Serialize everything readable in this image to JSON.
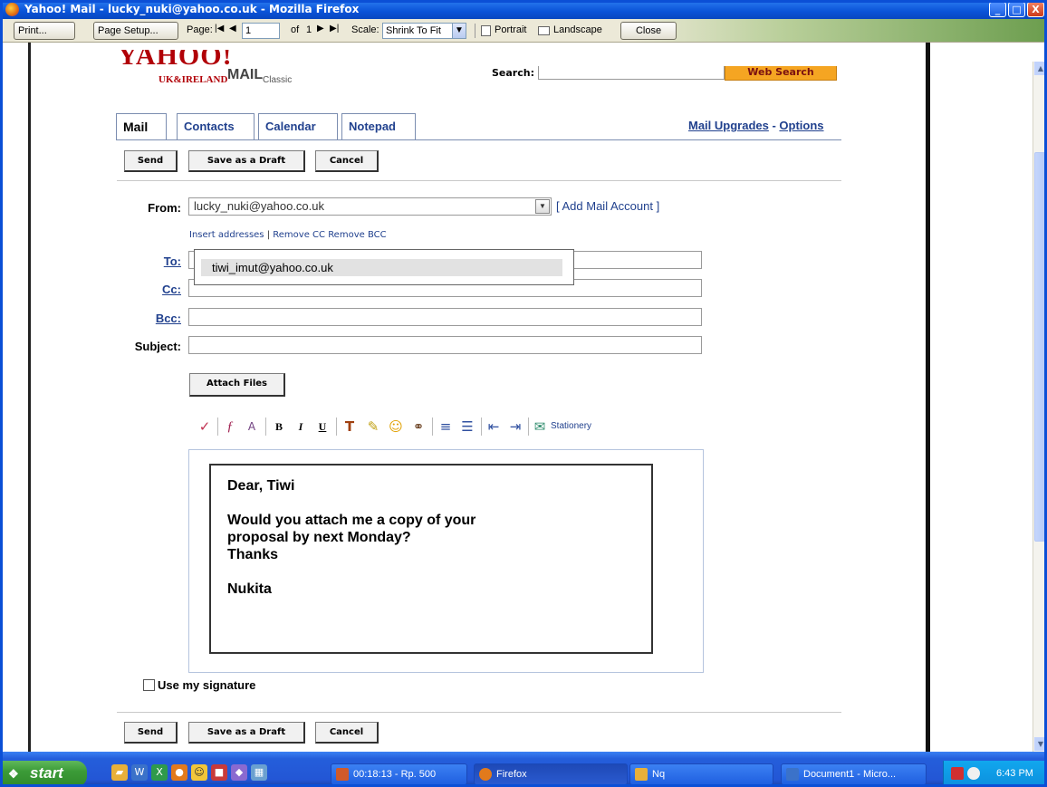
{
  "window": {
    "title": "Yahoo! Mail - lucky_nuki@yahoo.co.uk - Mozilla Firefox",
    "min": "_",
    "max": "□",
    "close": "X"
  },
  "print_toolbar": {
    "print": "Print...",
    "page_setup": "Page Setup...",
    "page_label": "Page:",
    "first": "|◀",
    "prev": "◀",
    "page_value": "1",
    "of_label": "of",
    "total_pages": "1",
    "next": "▶",
    "last": "▶|",
    "scale_label": "Scale:",
    "scale_value": "Shrink To Fit",
    "portrait": "Portrait",
    "landscape": "Landscape",
    "close": "Close"
  },
  "header": {
    "logo": "YAHOO!",
    "logo_mail": "MAIL",
    "logo_region": "UK&IRELAND",
    "logo_classic": "Classic",
    "search_label": "Search:",
    "search_value": "",
    "web_search": "Web Search"
  },
  "tabs": [
    {
      "label": "Mail"
    },
    {
      "label": "Contacts"
    },
    {
      "label": "Calendar"
    },
    {
      "label": "Notepad"
    }
  ],
  "top_links": {
    "upgrades": "Mail Upgrades",
    "sep": " - ",
    "options": "Options"
  },
  "actions": {
    "send": "Send",
    "draft": "Save as a Draft",
    "cancel": "Cancel"
  },
  "form": {
    "from_label": "From:",
    "from_value": "lucky_nuki@yahoo.co.uk",
    "add_account": "[ Add Mail Account ]",
    "insert_addresses": "Insert addresses",
    "remove_cc": "Remove CC",
    "remove_bcc": "Remove BCC",
    "to_label": "To:",
    "cc_label": "Cc:",
    "bcc_label": "Bcc:",
    "subject_label": "Subject:",
    "autocomplete_option": "tiwi_imut@yahoo.co.uk",
    "attach": "Attach Files"
  },
  "format_toolbar": {
    "items": [
      "spellcheck-icon",
      "font-icon",
      "font-size-icon",
      "bold-icon",
      "italic-icon",
      "underline-icon",
      "text-color-icon",
      "highlight-icon",
      "emoticon-icon",
      "link-icon",
      "align-icon",
      "bullets-icon",
      "outdent-icon",
      "indent-icon",
      "stationery-icon"
    ],
    "bold": "B",
    "italic": "I",
    "underline": "U",
    "stationery": "Stationery"
  },
  "message": {
    "lines": [
      "Dear, Tiwi",
      "",
      "Would you attach me a copy of your",
      "proposal by next Monday?",
      "Thanks",
      "",
      "Nukita"
    ]
  },
  "signature": {
    "label": "Use my signature",
    "checked": false
  },
  "taskbar": {
    "start": "start",
    "tasks": [
      {
        "label": "00:18:13 - Rp. 500"
      },
      {
        "label": "Firefox"
      },
      {
        "label": "Nq"
      },
      {
        "label": "Document1 - Micro..."
      }
    ],
    "clock": "6:43 PM"
  },
  "colors": {
    "link": "#21418e",
    "yahoo_red": "#b10007",
    "search_orange": "#f5a522",
    "titlebar": "#0a53d8"
  }
}
